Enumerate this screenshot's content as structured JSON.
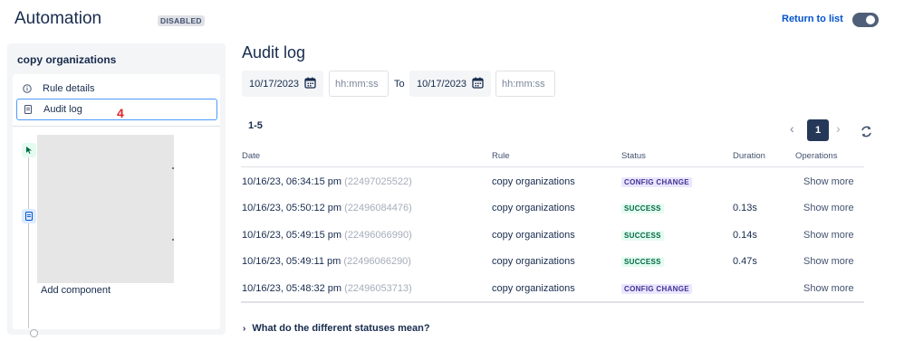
{
  "header": {
    "app_title": "Automation",
    "state_badge": "DISABLED",
    "return_link": "Return to list",
    "enabled_toggle": false
  },
  "sidebar": {
    "rule_name": "copy organizations",
    "items": [
      {
        "label": "Rule details",
        "icon": "info-icon"
      },
      {
        "label": "Audit log",
        "icon": "document-icon",
        "selected": true
      }
    ],
    "annotation": "4",
    "add_component": "Add component"
  },
  "main": {
    "title": "Audit log",
    "filter": {
      "from_date": "10/17/2023",
      "from_time_placeholder": "hh:mm:ss",
      "to_label": "To",
      "to_date": "10/17/2023",
      "to_time_placeholder": "hh:mm:ss"
    },
    "result_range": "1-5",
    "pagination": {
      "current_page": "1"
    },
    "columns": [
      "Date",
      "Rule",
      "Status",
      "Duration",
      "Operations"
    ],
    "rows": [
      {
        "date": "10/16/23, 06:34:15 pm",
        "id": "(22497025522)",
        "rule": "copy organizations",
        "status": "CONFIG CHANGE",
        "duration": "",
        "operation": "Show more"
      },
      {
        "date": "10/16/23, 05:50:12 pm",
        "id": "(22496084476)",
        "rule": "copy organizations",
        "status": "SUCCESS",
        "duration": "0.13s",
        "operation": "Show more"
      },
      {
        "date": "10/16/23, 05:49:15 pm",
        "id": "(22496066990)",
        "rule": "copy organizations",
        "status": "SUCCESS",
        "duration": "0.14s",
        "operation": "Show more"
      },
      {
        "date": "10/16/23, 05:49:11 pm",
        "id": "(22496066290)",
        "rule": "copy organizations",
        "status": "SUCCESS",
        "duration": "0.47s",
        "operation": "Show more"
      },
      {
        "date": "10/16/23, 05:48:32 pm",
        "id": "(22496053713)",
        "rule": "copy organizations",
        "status": "CONFIG CHANGE",
        "duration": "",
        "operation": "Show more"
      }
    ],
    "statuses_help": "What do the different statuses mean?"
  },
  "colors": {
    "link": "#0052cc",
    "success_bg": "#e3fcef",
    "success_text": "#006644",
    "config_bg": "#eae6ff",
    "config_text": "#403294",
    "annotation": "#e5252a"
  }
}
